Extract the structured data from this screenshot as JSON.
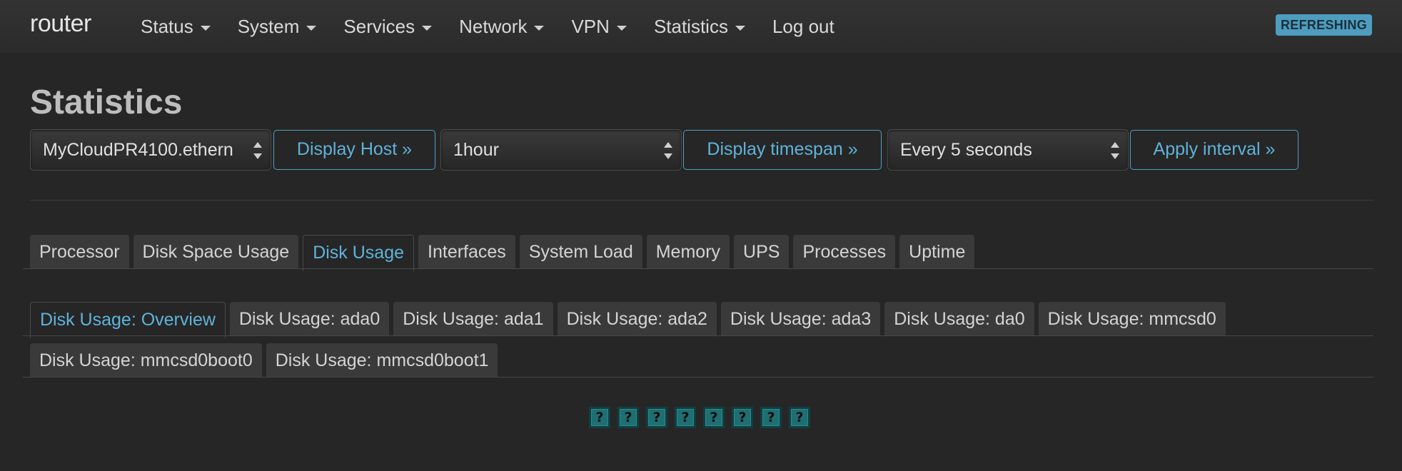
{
  "navbar": {
    "brand": "router",
    "menu": [
      {
        "label": "Status",
        "dropdown": true
      },
      {
        "label": "System",
        "dropdown": true
      },
      {
        "label": "Services",
        "dropdown": true
      },
      {
        "label": "Network",
        "dropdown": true
      },
      {
        "label": "VPN",
        "dropdown": true
      },
      {
        "label": "Statistics",
        "dropdown": true
      },
      {
        "label": "Log out",
        "dropdown": false
      }
    ],
    "badge": "REFRESHING"
  },
  "page": {
    "title": "Statistics"
  },
  "controls": {
    "host_select": "MyCloudPR4100.ethern",
    "display_host_button": "Display Host »",
    "timespan_select": "1hour",
    "display_timespan_button": "Display timespan »",
    "interval_select": "Every 5 seconds",
    "apply_interval_button": "Apply interval »"
  },
  "tabs": [
    {
      "label": "Processor",
      "active": false
    },
    {
      "label": "Disk Space Usage",
      "active": false
    },
    {
      "label": "Disk Usage",
      "active": true
    },
    {
      "label": "Interfaces",
      "active": false
    },
    {
      "label": "System Load",
      "active": false
    },
    {
      "label": "Memory",
      "active": false
    },
    {
      "label": "UPS",
      "active": false
    },
    {
      "label": "Processes",
      "active": false
    },
    {
      "label": "Uptime",
      "active": false
    }
  ],
  "subtabs_row1": [
    {
      "label": "Disk Usage: Overview",
      "active": true
    },
    {
      "label": "Disk Usage: ada0",
      "active": false
    },
    {
      "label": "Disk Usage: ada1",
      "active": false
    },
    {
      "label": "Disk Usage: ada2",
      "active": false
    },
    {
      "label": "Disk Usage: ada3",
      "active": false
    },
    {
      "label": "Disk Usage: da0",
      "active": false
    },
    {
      "label": "Disk Usage: mmcsd0",
      "active": false
    }
  ],
  "subtabs_row2": [
    {
      "label": "Disk Usage: mmcsd0boot0",
      "active": false
    },
    {
      "label": "Disk Usage: mmcsd0boot1",
      "active": false
    }
  ],
  "placeholders": [
    "?",
    "?",
    "?",
    "?",
    "?",
    "?",
    "?",
    "?"
  ],
  "colors": {
    "accent": "#5eb3da",
    "background": "#262626",
    "badge": "#4e9dbf"
  }
}
